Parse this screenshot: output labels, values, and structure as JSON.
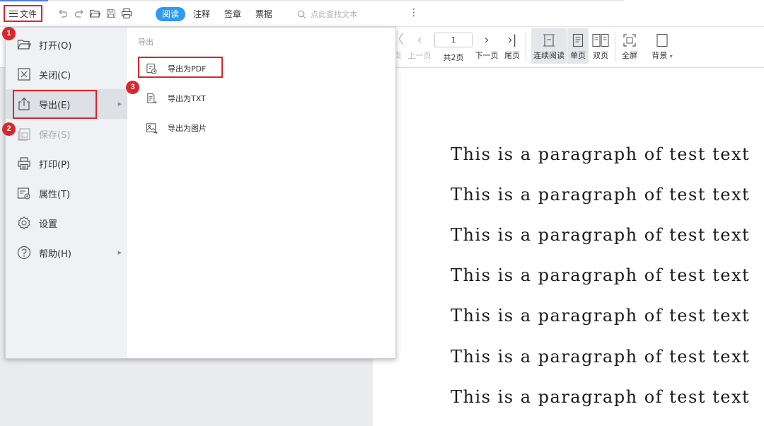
{
  "topbar": {
    "file_menu_label": "文件",
    "tabs": [
      {
        "label": "阅读",
        "active": true
      },
      {
        "label": "注释",
        "active": false
      },
      {
        "label": "签章",
        "active": false
      },
      {
        "label": "票据",
        "active": false
      }
    ],
    "search_placeholder": "点此查找文本",
    "more_glyph": "⋮"
  },
  "readbar": {
    "prev_label": "上一页",
    "first_label_partial": "页",
    "page_value": "1",
    "total_pages": "共2页",
    "next_label": "下一页",
    "last_label": "尾页",
    "continuous_label": "连续阅读",
    "single_label": "单页",
    "double_label": "双页",
    "fullscreen_label": "全屏",
    "background_label": "背景"
  },
  "file_menu": {
    "items": [
      {
        "label": "打开(O)",
        "icon": "folder-open-icon"
      },
      {
        "label": "关闭(C)",
        "icon": "close-box-icon"
      },
      {
        "label": "导出(E)",
        "icon": "export-icon"
      },
      {
        "label": "保存(S)",
        "icon": "save-icon"
      },
      {
        "label": "打印(P)",
        "icon": "printer-icon"
      },
      {
        "label": "属性(T)",
        "icon": "properties-icon"
      },
      {
        "label": "设置",
        "icon": "gear-icon"
      },
      {
        "label": "帮助(H)",
        "icon": "help-icon"
      }
    ],
    "submenu_title": "导出",
    "submenu_items": [
      {
        "label": "导出为PDF",
        "icon": "export-pdf-icon"
      },
      {
        "label": "导出为TXT",
        "icon": "export-txt-icon"
      },
      {
        "label": "导出为图片",
        "icon": "export-image-icon"
      }
    ]
  },
  "annotations": {
    "badge_1": "1",
    "badge_2": "2",
    "badge_3": "3",
    "highlight_color": "#d9262c"
  },
  "document": {
    "paragraphs": [
      "This is a paragraph of test text",
      "This is a paragraph of test text",
      "This is a paragraph of test text",
      "This is a paragraph of test text",
      "This is a paragraph of test text",
      "This is a paragraph of test text",
      "This is a paragraph of test text"
    ]
  },
  "colors": {
    "accent_blue": "#2e9af0",
    "annotation_red": "#d9262c"
  }
}
